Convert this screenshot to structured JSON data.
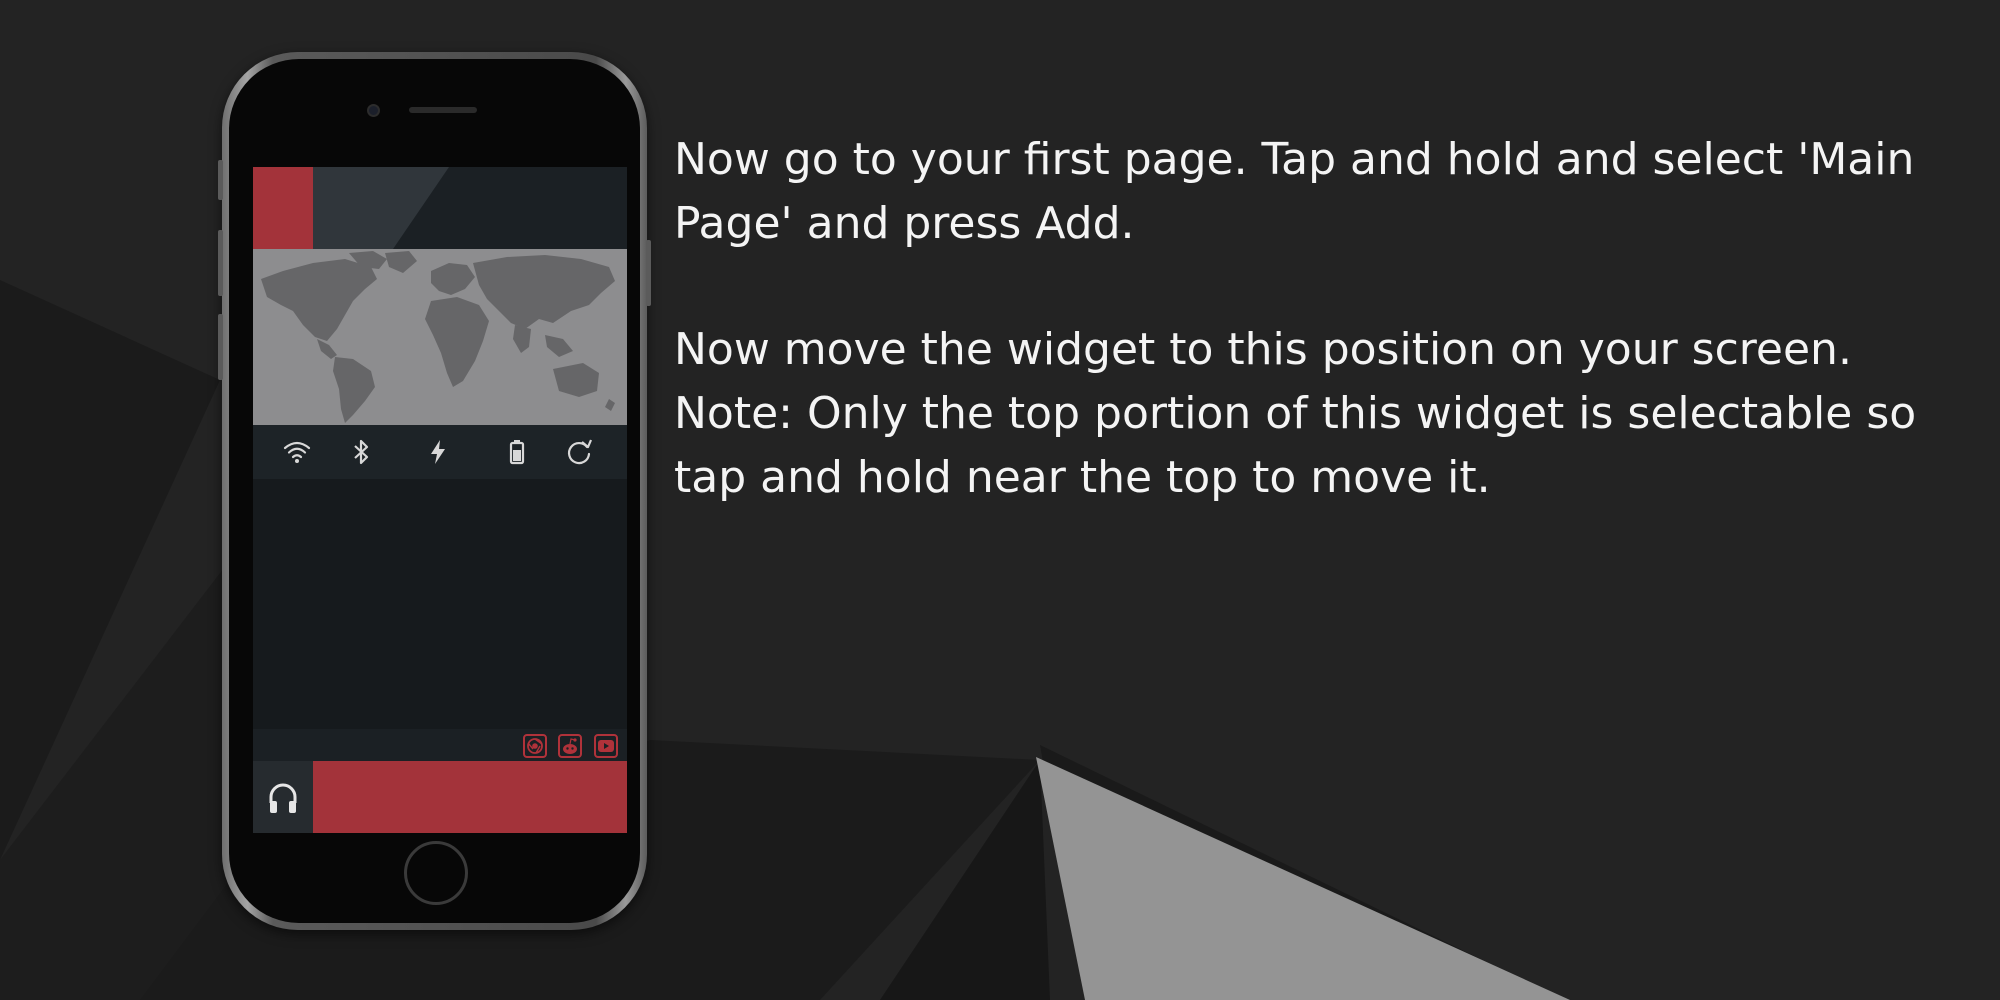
{
  "instructions": {
    "paragraph_1": "Now go to your first page. Tap and hold and select 'Main Page' and press Add.",
    "paragraph_2": "Now move the widget to this position on your screen. Note: Only the top portion of this widget is selectable so tap and hold near the top to move it."
  },
  "phone_screen": {
    "status_icons": [
      "wifi-icon",
      "bluetooth-icon",
      "lightning-icon",
      "battery-icon",
      "refresh-icon"
    ],
    "app_shortcuts": [
      "chrome-icon",
      "reddit-icon",
      "youtube-icon"
    ],
    "music_control_icon": "headphones-icon"
  },
  "colors": {
    "background": "#232323",
    "accent_red": "#a3333a",
    "screen_dark": "#15191c",
    "map_gray": "#8d8d8f",
    "text": "#f4f4f4"
  }
}
